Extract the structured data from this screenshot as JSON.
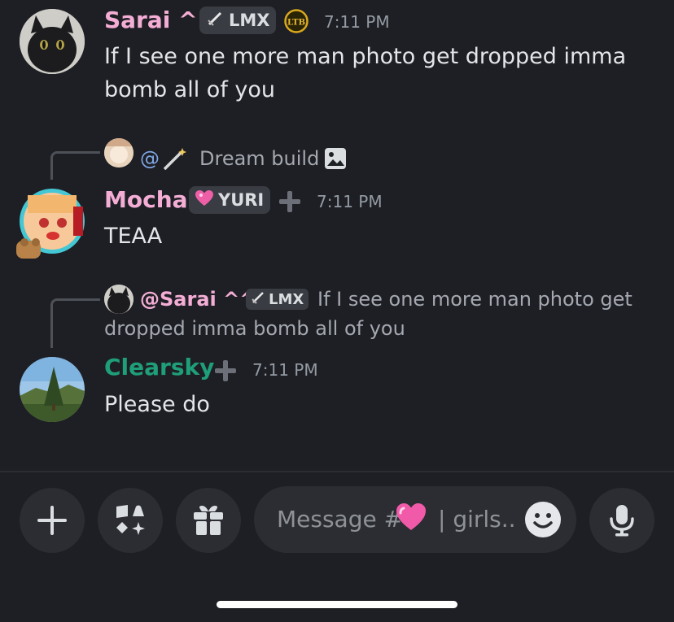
{
  "messages": [
    {
      "username": "Sarai ^^",
      "username_color": "#f4aed6",
      "tag": "LMX",
      "badge_icon": "ltb-badge",
      "time": "7:11 PM",
      "text_lines": [
        "If I see one more man photo get dropped imma",
        "bomb all of you"
      ]
    },
    {
      "reply": {
        "mention": "@",
        "text": "Dream build",
        "attachment_icon": "image-icon"
      },
      "username": "Mocha",
      "username_color": "#f4aed6",
      "tag": "YURI",
      "time": "7:11 PM",
      "text_lines": [
        "TEAA"
      ]
    },
    {
      "reply": {
        "mention": "@Sarai ^^",
        "tag": "LMX",
        "text_line1": "If I see one more man photo get",
        "text_line2": "dropped imma bomb all of you"
      },
      "username": "Clearsky",
      "username_color": "#1f9e7a",
      "time": "7:11 PM",
      "text_lines": [
        "Please do"
      ]
    }
  ],
  "composer": {
    "placeholder": "Message #",
    "placeholder_suffix": "| girls..",
    "buttons": [
      "plus-icon",
      "apps-icon",
      "gift-icon",
      "emoji-icon",
      "microphone-icon"
    ]
  }
}
